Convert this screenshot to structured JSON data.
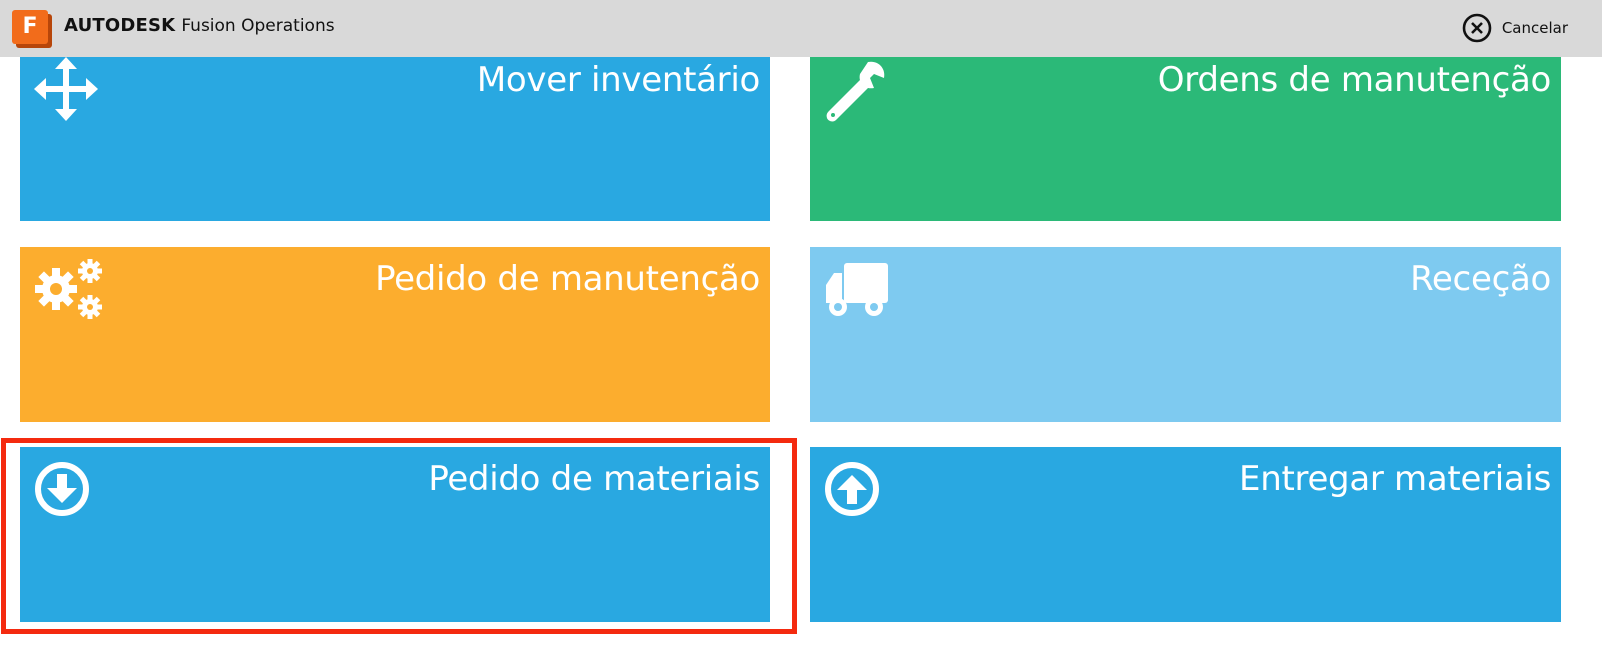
{
  "header": {
    "logo_letter": "F",
    "brand_bold": "AUTODESK",
    "brand_product": "Fusion Operations",
    "cancel_label": "Cancelar"
  },
  "tiles": [
    {
      "label": "Mover inventário",
      "color": "#29a8e1",
      "icon": "move-arrows-icon"
    },
    {
      "label": "Ordens de manutenção",
      "color": "#2bb978",
      "icon": "wrench-icon"
    },
    {
      "label": "Pedido de manutenção",
      "color": "#fcad2e",
      "icon": "gears-icon"
    },
    {
      "label": "Receção",
      "color": "#7ecaf0",
      "icon": "truck-icon"
    },
    {
      "label": "Pedido de materiais",
      "color": "#29a8e1",
      "icon": "arrow-down-circle-icon"
    },
    {
      "label": "Entregar materiais",
      "color": "#29a8e1",
      "icon": "arrow-up-circle-icon"
    }
  ],
  "highlight_color": "#f42a0f"
}
